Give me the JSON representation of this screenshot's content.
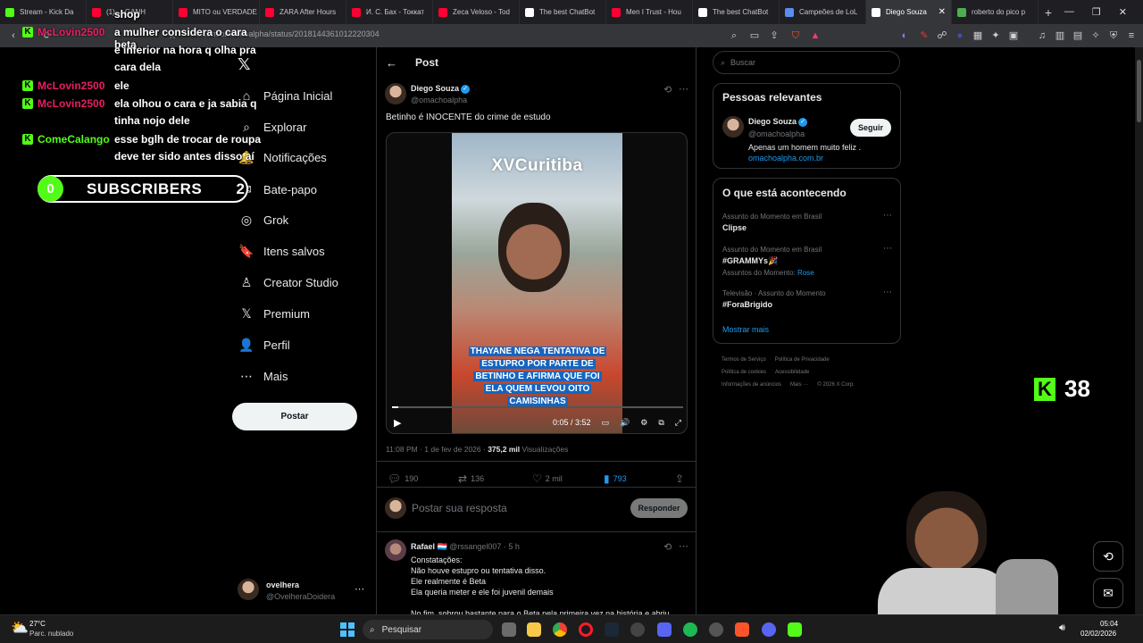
{
  "browser": {
    "tabs": [
      {
        "label": "Stream - Kick Da",
        "color": "#53fc18"
      },
      {
        "label": "(1) ... GANH",
        "color": "#ff0033"
      },
      {
        "label": "MITO ou VERDADE",
        "color": "#ff0033"
      },
      {
        "label": "ZARA After Hours",
        "color": "#ff0033"
      },
      {
        "label": "И. С. Бах - Токкат",
        "color": "#ff0033"
      },
      {
        "label": "Zeca Veloso - Tod",
        "color": "#ff0033"
      },
      {
        "label": "The best ChatBot",
        "color": "#ffffff"
      },
      {
        "label": "Men I Trust - Hou",
        "color": "#ff0033"
      },
      {
        "label": "The best ChatBot",
        "color": "#ffffff"
      },
      {
        "label": "Campeões de LoL",
        "color": "#5b8def"
      },
      {
        "label": "Diego Souza",
        "color": "#ffffff",
        "active": true
      },
      {
        "label": "roberto do pico p",
        "color": "#4caf50"
      }
    ],
    "url": "x.com/omachoalpha/status/2018144361012220304"
  },
  "stream": {
    "chat_lines": [
      {
        "name": "",
        "text": "shop"
      },
      {
        "name": "McLovin2500",
        "name_color": "#e91e63",
        "text": "a mulher considera o cara beta"
      },
      {
        "name": "",
        "text": "e inferior na hora q olha pra"
      },
      {
        "name": "",
        "text": "cara dela"
      },
      {
        "name": "McLovin2500",
        "name_color": "#e91e63",
        "text": "ele"
      },
      {
        "name": "McLovin2500",
        "name_color": "#e91e63",
        "text": "ela olhou o cara e ja sabia q"
      },
      {
        "name": "",
        "text": "tinha nojo dele"
      },
      {
        "name": "ComeCalango",
        "name_color": "#53fc18",
        "text": "esse bglh de trocar de roupa"
      },
      {
        "name": "",
        "text": "deve ter sido antes disso aí"
      }
    ],
    "subs_count": "0",
    "subs_label": "SUBSCRIBERS",
    "subs_goal": "2",
    "viewer_count": "38"
  },
  "nav": {
    "items": [
      {
        "label": "Página Inicial",
        "icon": "home-icon",
        "glyph": "⌂"
      },
      {
        "label": "Explorar",
        "icon": "search-icon",
        "glyph": "⌕"
      },
      {
        "label": "Notificações",
        "icon": "bell-icon",
        "glyph": "🔔"
      },
      {
        "label": "Bate-papo",
        "icon": "chat-icon",
        "glyph": "✉"
      },
      {
        "label": "Grok",
        "icon": "grok-icon",
        "glyph": "◎"
      },
      {
        "label": "Itens salvos",
        "icon": "bookmark-icon",
        "glyph": "🔖"
      },
      {
        "label": "Creator Studio",
        "icon": "creator-icon",
        "glyph": "♙"
      },
      {
        "label": "Premium",
        "icon": "x-premium-icon",
        "glyph": "𝕏"
      },
      {
        "label": "Perfil",
        "icon": "profile-icon",
        "glyph": "👤"
      },
      {
        "label": "Mais",
        "icon": "more-icon",
        "glyph": "⋯"
      }
    ],
    "post_label": "Postar",
    "account_name": "ovelhera",
    "account_handle": "@OvelheraDoidera"
  },
  "post": {
    "header": "Post",
    "author_name": "Diego Souza",
    "author_handle": "@omachoalpha",
    "text": "Betinho é INOCENTE do crime de estudo",
    "video_title": "XVCuritiba",
    "video_caption": "THAYANE NEGA TENTATIVA DE ESTUPRO POR PARTE DE BETINHO E AFIRMA QUE FOI ELA QUEM LEVOU OITO CAMISINHAS",
    "video_time": "0:05 / 3:52",
    "video_progress": 0.023,
    "timestamp": "11:08 PM · 1 de fev de 2026 · ",
    "views": "375,2 mil",
    "views_label": "Visualizações",
    "stats": {
      "replies": "190",
      "reposts": "136",
      "likes": "2 mil",
      "bookmarks": "793"
    },
    "reply_placeholder": "Postar sua resposta",
    "reply_button": "Responder"
  },
  "reply": {
    "author_name": "Rafael 🇱🇺",
    "author_handle": "@rssangel007 · 5 h",
    "lines": [
      "Constatações:",
      "Não houve estupro ou tentativa disso.",
      "Ele realmente é Beta",
      "Ela queria meter e ele foi juvenil demais",
      "",
      "No fim, sobrou bastante para o Beta pela primeira vez na história e abriu"
    ]
  },
  "sidebar": {
    "search_placeholder": "Buscar",
    "relevant_title": "Pessoas relevantes",
    "person_name": "Diego Souza",
    "person_handle": "@omachoalpha",
    "person_bio": "Apenas um homem muito feliz .",
    "person_link": "omachoalpha.com.br",
    "follow_label": "Seguir",
    "trending_title": "O que está acontecendo",
    "trends": [
      {
        "context": "Assunto do Momento em Brasil",
        "name": "Clipse",
        "extra": ""
      },
      {
        "context": "Assunto do Momento em Brasil",
        "name": "#GRAMMYs🎉",
        "extra_prefix": "Assuntos do Momento: ",
        "extra": "Rose"
      },
      {
        "context": "Televisão · Assunto do Momento",
        "name": "#ForaBrigido",
        "extra": ""
      }
    ],
    "show_more": "Mostrar mais",
    "footer_links": [
      "Termos de Serviço",
      "Política de Privacidade",
      "Política de cookies",
      "Acessibilidade",
      "Informações de anúncios",
      "Mais ···",
      "© 2026 X Corp."
    ]
  },
  "taskbar": {
    "weather_temp": "27°C",
    "weather_desc": "Parc. nublado",
    "search_label": "Pesquisar",
    "time": "05:04",
    "date": "02/02/2026"
  },
  "colors": {
    "x_blue": "#1d9bf0",
    "kick_green": "#53fc18"
  }
}
